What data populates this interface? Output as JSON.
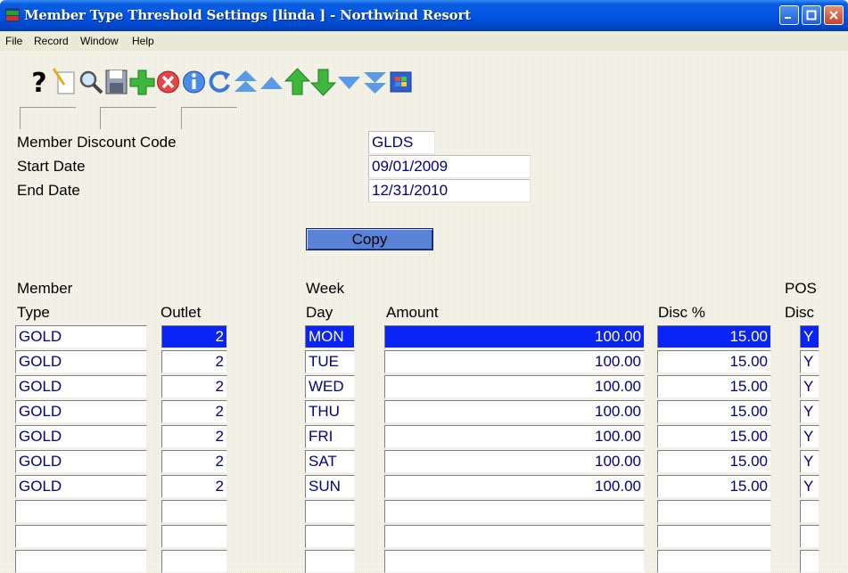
{
  "window": {
    "title": "Member Type Threshold Settings [linda    ] - Northwind Resort",
    "icon": "app-icon",
    "buttons": [
      "minimize-icon",
      "maximize-icon",
      "close-icon"
    ]
  },
  "menu": {
    "items": [
      "File",
      "Record",
      "Window",
      "Help"
    ]
  },
  "toolbar": {
    "icons": [
      "help-icon",
      "new-record-icon",
      "search-icon",
      "save-icon",
      "add-icon",
      "delete-icon",
      "info-icon",
      "refresh-icon",
      "first-record-icon",
      "previous-record-icon",
      "up-icon",
      "down-icon",
      "next-record-icon",
      "last-record-icon",
      "windows-icon"
    ]
  },
  "form": {
    "member_discount_code": {
      "label": "Member Discount Code",
      "value": "GLDS"
    },
    "start_date": {
      "label": "Start Date",
      "value": "09/01/2009"
    },
    "end_date": {
      "label": "End Date",
      "value": "12/31/2010"
    },
    "copy_label": "Copy"
  },
  "grid": {
    "headers": {
      "member_type_line1": "Member",
      "member_type_line2": "Type",
      "outlet": "Outlet",
      "week_day_line1": "Week",
      "week_day_line2": "Day",
      "amount": "Amount",
      "disc_pct": "Disc %",
      "pos_disc_line1": "POS",
      "pos_disc_line2": "Disc"
    },
    "rows": [
      {
        "member_type": "GOLD",
        "outlet": "2",
        "week_day": "MON",
        "amount": "100.00",
        "disc_pct": "15.00",
        "pos_disc": "Y"
      },
      {
        "member_type": "GOLD",
        "outlet": "2",
        "week_day": "TUE",
        "amount": "100.00",
        "disc_pct": "15.00",
        "pos_disc": "Y"
      },
      {
        "member_type": "GOLD",
        "outlet": "2",
        "week_day": "WED",
        "amount": "100.00",
        "disc_pct": "15.00",
        "pos_disc": "Y"
      },
      {
        "member_type": "GOLD",
        "outlet": "2",
        "week_day": "THU",
        "amount": "100.00",
        "disc_pct": "15.00",
        "pos_disc": "Y"
      },
      {
        "member_type": "GOLD",
        "outlet": "2",
        "week_day": "FRI",
        "amount": "100.00",
        "disc_pct": "15.00",
        "pos_disc": "Y"
      },
      {
        "member_type": "GOLD",
        "outlet": "2",
        "week_day": "SAT",
        "amount": "100.00",
        "disc_pct": "15.00",
        "pos_disc": "Y"
      },
      {
        "member_type": "GOLD",
        "outlet": "2",
        "week_day": "SUN",
        "amount": "100.00",
        "disc_pct": "15.00",
        "pos_disc": "Y"
      },
      {
        "member_type": "",
        "outlet": "",
        "week_day": "",
        "amount": "",
        "disc_pct": "",
        "pos_disc": ""
      },
      {
        "member_type": "",
        "outlet": "",
        "week_day": "",
        "amount": "",
        "disc_pct": "",
        "pos_disc": ""
      },
      {
        "member_type": "",
        "outlet": "",
        "week_day": "",
        "amount": "",
        "disc_pct": "",
        "pos_disc": ""
      }
    ],
    "selected_row": 0,
    "selection_color": "#0a24f5"
  }
}
